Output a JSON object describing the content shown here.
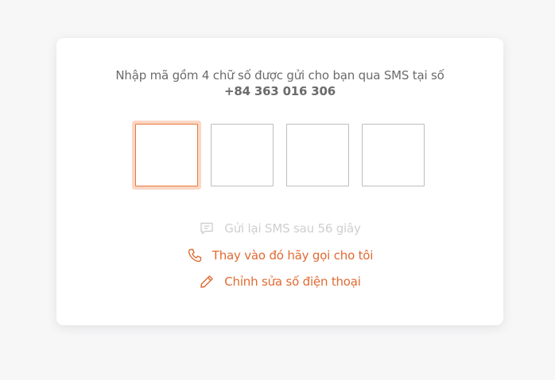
{
  "prompt": {
    "text": "Nhập mã gồm 4 chữ số được gửi cho bạn qua SMS tại số",
    "phone": "+84 363 016 306"
  },
  "otp": {
    "digits": [
      "",
      "",
      "",
      ""
    ],
    "focused_index": 0
  },
  "actions": {
    "resend_label": "Gửi lại SMS sau 56 giây",
    "call_label": "Thay vào đó hãy gọi cho tôi",
    "edit_label": "Chỉnh sửa số điện thoại"
  },
  "icons": {
    "resend": "message-icon",
    "call": "phone-icon",
    "edit": "pencil-icon"
  },
  "colors": {
    "accent": "#e06a32",
    "focus_ring": "#fbd7c4",
    "disabled_text": "#cfcfcf",
    "body_text": "#6b6b6b"
  }
}
